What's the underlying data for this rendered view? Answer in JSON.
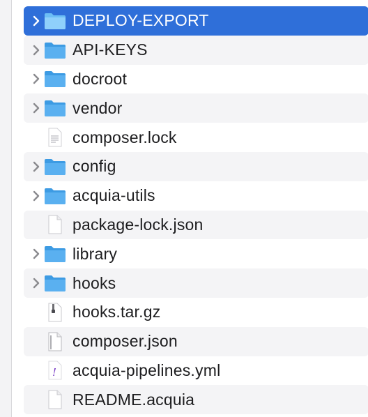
{
  "colors": {
    "selection": "#2f6fd9",
    "folder": "#5ab0f0",
    "stripe": "#f4f4f6"
  },
  "items": [
    {
      "label": "DEPLOY-EXPORT",
      "kind": "folder",
      "icon": "folder-icon",
      "selected": true
    },
    {
      "label": "API-KEYS",
      "kind": "folder",
      "icon": "folder-icon"
    },
    {
      "label": "docroot",
      "kind": "folder",
      "icon": "folder-icon"
    },
    {
      "label": "vendor",
      "kind": "folder",
      "icon": "folder-icon"
    },
    {
      "label": "composer.lock",
      "kind": "file",
      "icon": "text-file-icon"
    },
    {
      "label": "config",
      "kind": "folder",
      "icon": "folder-icon"
    },
    {
      "label": "acquia-utils",
      "kind": "folder",
      "icon": "folder-icon"
    },
    {
      "label": "package-lock.json",
      "kind": "file",
      "icon": "blank-file-icon"
    },
    {
      "label": "library",
      "kind": "folder",
      "icon": "folder-icon"
    },
    {
      "label": "hooks",
      "kind": "folder",
      "icon": "folder-icon"
    },
    {
      "label": "hooks.tar.gz",
      "kind": "file",
      "icon": "archive-file-icon"
    },
    {
      "label": "composer.json",
      "kind": "file",
      "icon": "json-file-icon"
    },
    {
      "label": "acquia-pipelines.yml",
      "kind": "file",
      "icon": "yaml-file-icon"
    },
    {
      "label": "README.acquia",
      "kind": "file",
      "icon": "blank-file-icon"
    }
  ]
}
